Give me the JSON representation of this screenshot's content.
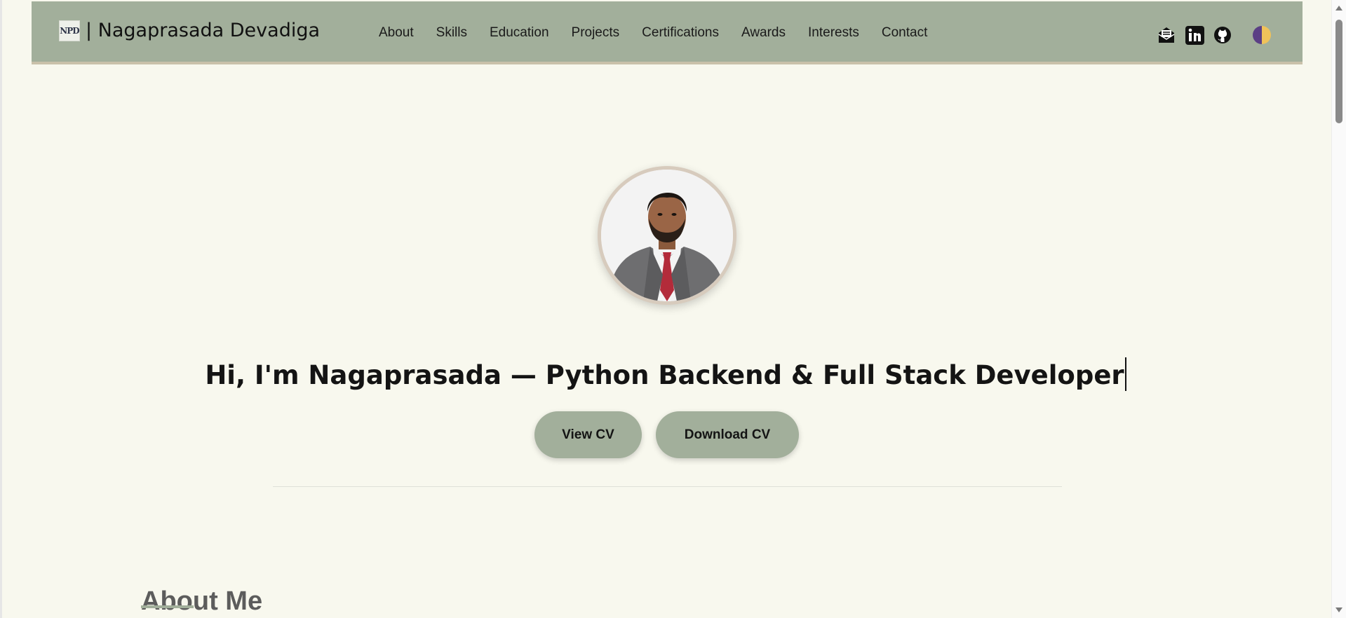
{
  "brand": {
    "logo_text": "NPD",
    "name": "| Nagaprasada Devadiga"
  },
  "nav": {
    "links": [
      "About",
      "Skills",
      "Education",
      "Projects",
      "Certifications",
      "Awards",
      "Interests",
      "Contact"
    ]
  },
  "nav_icons": [
    "mail-icon",
    "linkedin-icon",
    "github-icon"
  ],
  "theme_toggle_colors": [
    "#5b3f85",
    "#f0c25a"
  ],
  "hero": {
    "headline": "Hi, I'm Nagaprasada — Python Backend & Full Stack Developer",
    "view_cv": "View CV",
    "download_cv": "Download CV"
  },
  "about": {
    "title": "About Me"
  },
  "colors": {
    "navbar": "#a2af9b",
    "background": "#f8f8ee",
    "button": "#a2af9b"
  }
}
